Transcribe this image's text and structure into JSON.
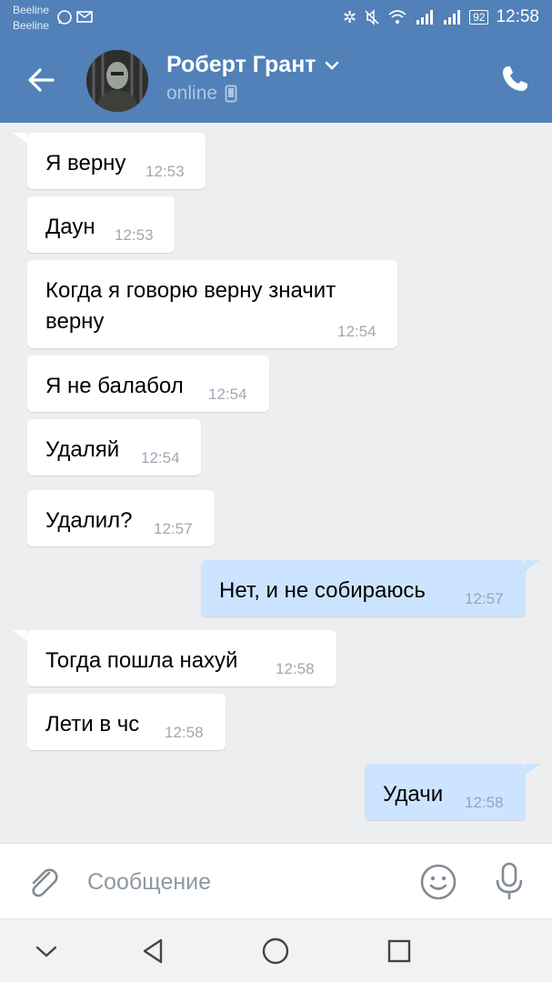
{
  "status_bar": {
    "carrier_1": "Beeline",
    "carrier_2": "Beeline",
    "battery": "92",
    "time": "12:58"
  },
  "header": {
    "contact_name": "Роберт Грант",
    "status": "online",
    "background_color": "#5181b8"
  },
  "messages": [
    {
      "text": "Я верну",
      "time": "12:53",
      "direction": "in"
    },
    {
      "text": "Даун",
      "time": "12:53",
      "direction": "in"
    },
    {
      "text_lines": [
        "Когда я говорю верну значит",
        "верну"
      ],
      "time": "12:54",
      "direction": "in"
    },
    {
      "text": "Я не балабол",
      "time": "12:54",
      "direction": "in"
    },
    {
      "text": "Удаляй",
      "time": "12:54",
      "direction": "in"
    },
    {
      "text": "Удалил?",
      "time": "12:57",
      "direction": "in"
    },
    {
      "text": "Нет, и не собираюсь",
      "time": "12:57",
      "direction": "out"
    },
    {
      "text": "Тогда пошла нахуй",
      "time": "12:58",
      "direction": "in"
    },
    {
      "text": "Лети в чс",
      "time": "12:58",
      "direction": "in"
    },
    {
      "text": "Удачи",
      "time": "12:58",
      "direction": "out"
    }
  ],
  "composer": {
    "placeholder": "Сообщение"
  },
  "icons": {
    "back": "arrow-left-icon",
    "call": "phone-icon",
    "attach": "paperclip-icon",
    "emoji": "smiley-icon",
    "mic": "microphone-icon"
  }
}
